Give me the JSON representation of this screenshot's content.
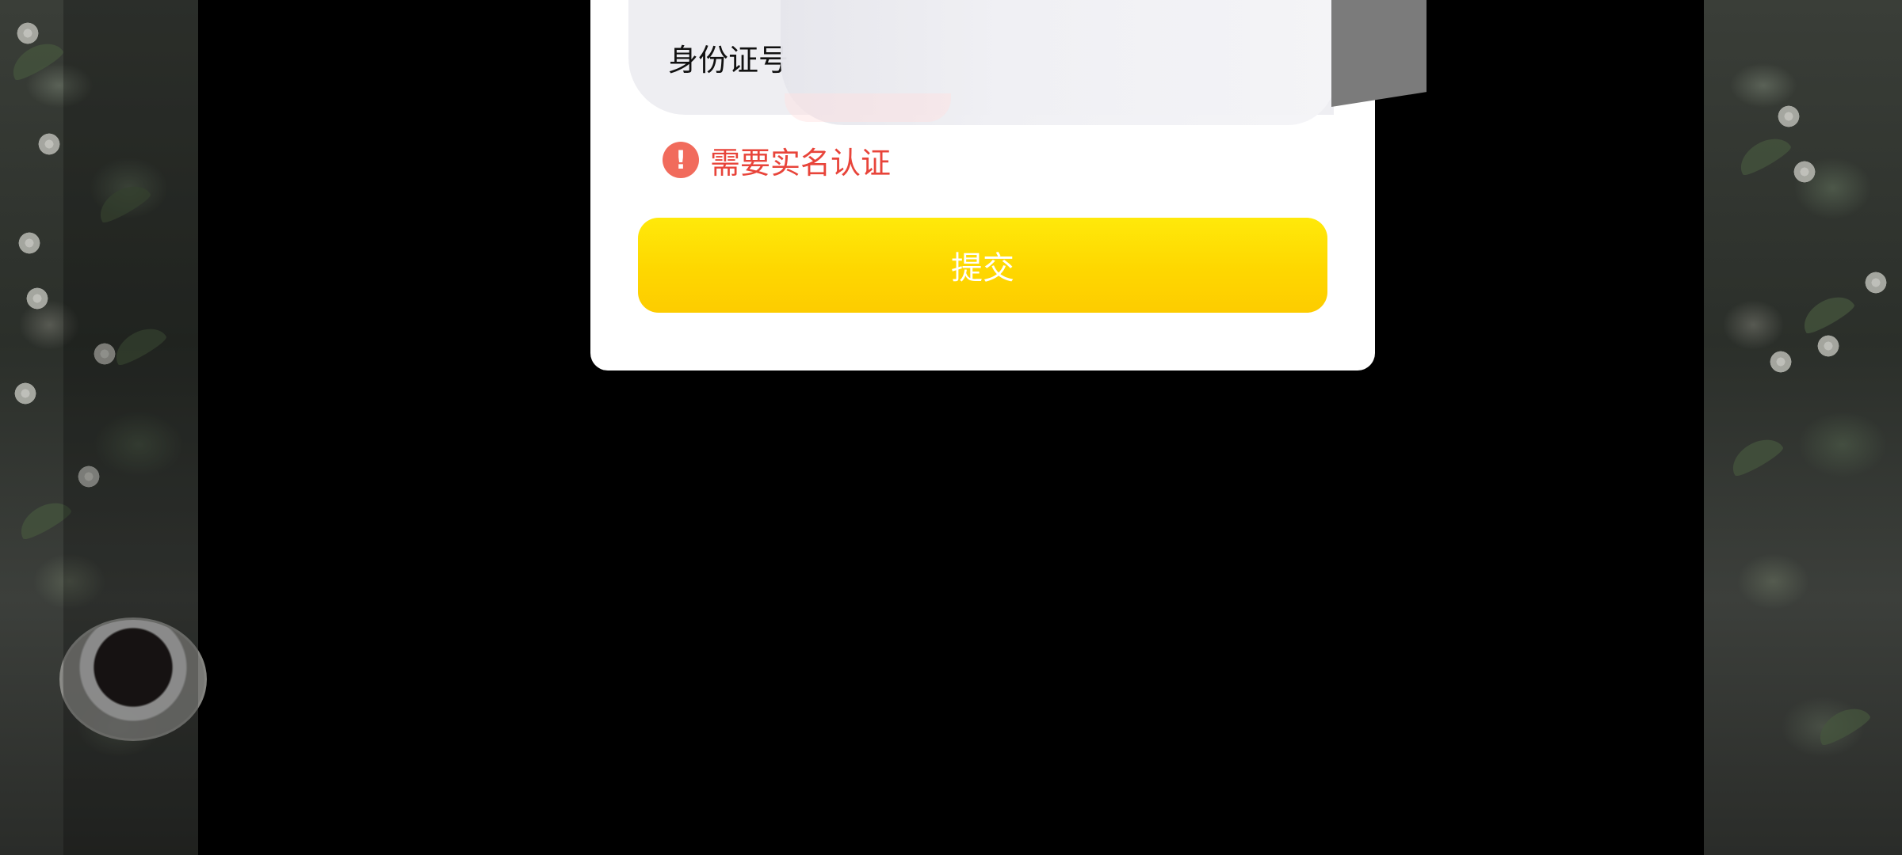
{
  "dialog": {
    "id_field": {
      "label": "身份证号"
    },
    "warning": {
      "icon": "exclamation-circle-icon",
      "icon_glyph": "!",
      "text": "需要实名认证",
      "color": "#e8443a"
    },
    "submit": {
      "label": "提交",
      "color": "#fed700"
    }
  }
}
